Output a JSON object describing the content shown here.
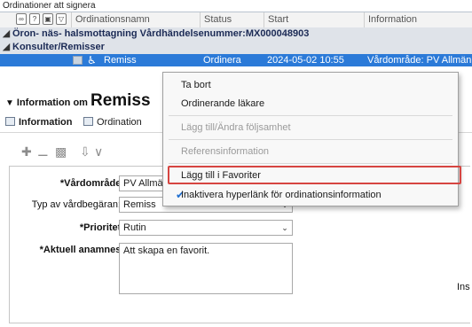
{
  "grid": {
    "title": "Ordinationer att signera",
    "columns": [
      "Ordinationsnamn",
      "Status",
      "Start",
      "Information"
    ],
    "header_icons": [
      "link-icon",
      "help-icon",
      "tag-icon",
      "filter-icon"
    ],
    "group1": "Öron- näs- halsmottagning Vårdhändelsenummer:MX000048903",
    "group2": "Konsulter/Remisser",
    "selected_row": {
      "name": "Remiss",
      "status": "Ordinera",
      "start": "2024-05-02 10:55",
      "info": "Vårdområde: PV Allmän"
    },
    "accent_color": "#2b7ad8"
  },
  "info": {
    "prefix": "Information om",
    "title": "Remiss"
  },
  "tabs": [
    {
      "label": "Information"
    },
    {
      "label": "Ordination"
    }
  ],
  "form": {
    "vardomrade_label": "*Vårdområde:",
    "vardomrade_value": "PV Allmän",
    "typ_label": "Typ av vårdbegäran:",
    "typ_value": "Remiss",
    "prioritet_label": "*Prioritet:",
    "prioritet_value": "Rutin",
    "anamnes_label": "*Aktuell anamnes:",
    "anamnes_value": "Att skapa en favorit.",
    "right_fragment": "Ins"
  },
  "context_menu": {
    "items": [
      {
        "label": "Ta bort",
        "enabled": true
      },
      {
        "label": "Ordinerande läkare",
        "enabled": true
      },
      {
        "label": "Lägg till/Ändra följsamhet",
        "enabled": false
      },
      {
        "label": "Referensinformation",
        "enabled": false
      },
      {
        "label": "Lägg till i Favoriter",
        "enabled": true,
        "highlighted": true
      },
      {
        "label": "Inaktivera hyperlänk för ordinationsinformation",
        "enabled": true,
        "checked": true
      }
    ],
    "highlight_color": "#d64541"
  }
}
